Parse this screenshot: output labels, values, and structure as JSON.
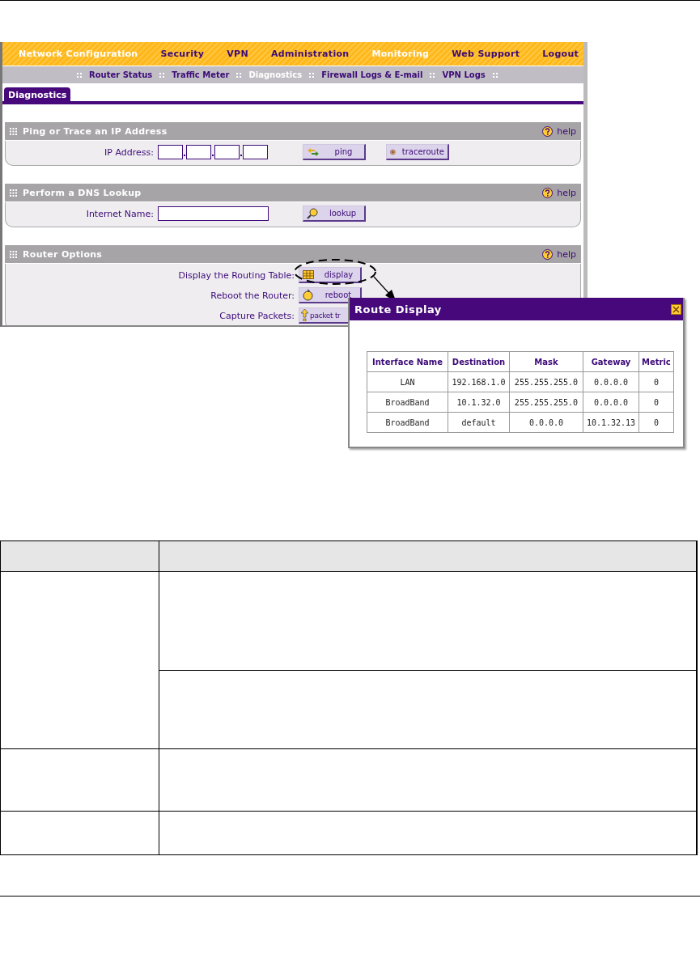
{
  "top_nav": [
    {
      "label": "Network Configuration",
      "selected": true
    },
    {
      "label": "Security",
      "selected": false
    },
    {
      "label": "VPN",
      "selected": false
    },
    {
      "label": "Administration",
      "selected": false
    },
    {
      "label": "Monitoring",
      "selected": true
    },
    {
      "label": "Web Support",
      "selected": false
    },
    {
      "label": "Logout",
      "selected": false
    }
  ],
  "sub_nav": [
    {
      "label": "Router Status",
      "selected": false
    },
    {
      "label": "Traffic Meter",
      "selected": false
    },
    {
      "label": "Diagnostics",
      "selected": true
    },
    {
      "label": "Firewall Logs & E-mail",
      "selected": false
    },
    {
      "label": "VPN Logs",
      "selected": false
    }
  ],
  "tab": {
    "label": "Diagnostics",
    "selected": true
  },
  "sections": [
    {
      "title": "Ping or Trace an IP Address",
      "help": "help",
      "rows": [
        {
          "kind": "ip",
          "label": "IP Address:",
          "buttons": [
            {
              "kind": "ping",
              "label": "ping"
            },
            {
              "kind": "traceroute",
              "label": "traceroute"
            }
          ]
        }
      ]
    },
    {
      "title": "Perform a DNS Lookup",
      "help": "help",
      "rows": [
        {
          "kind": "name",
          "label": "Internet Name:",
          "buttons": [
            {
              "kind": "lookup",
              "label": "lookup"
            }
          ]
        }
      ]
    },
    {
      "title": "Router Options",
      "help": "help",
      "rows": [
        {
          "kind": "option",
          "label": "Display the Routing Table:",
          "buttons": [
            {
              "kind": "display",
              "label": "display"
            }
          ]
        },
        {
          "kind": "option",
          "label": "Reboot the Router:",
          "buttons": [
            {
              "kind": "reboot",
              "label": "reboot"
            }
          ]
        },
        {
          "kind": "option",
          "label": "Capture Packets:",
          "buttons": [
            {
              "kind": "packet",
              "label": "packet tr"
            }
          ]
        }
      ]
    }
  ],
  "popup": {
    "callout": true,
    "title": "Route Display",
    "columns": [
      "Interface Name",
      "Destination",
      "Mask",
      "Gateway",
      "Metric"
    ],
    "rows": [
      [
        "LAN",
        "192.168.1.0",
        "255.255.255.0",
        "0.0.0.0",
        "0"
      ],
      [
        "BroadBand",
        "10.1.32.0",
        "255.255.255.0",
        "0.0.0.0",
        "0"
      ],
      [
        "BroadBand",
        "default",
        "0.0.0.0",
        "10.1.32.13",
        "0"
      ]
    ]
  }
}
